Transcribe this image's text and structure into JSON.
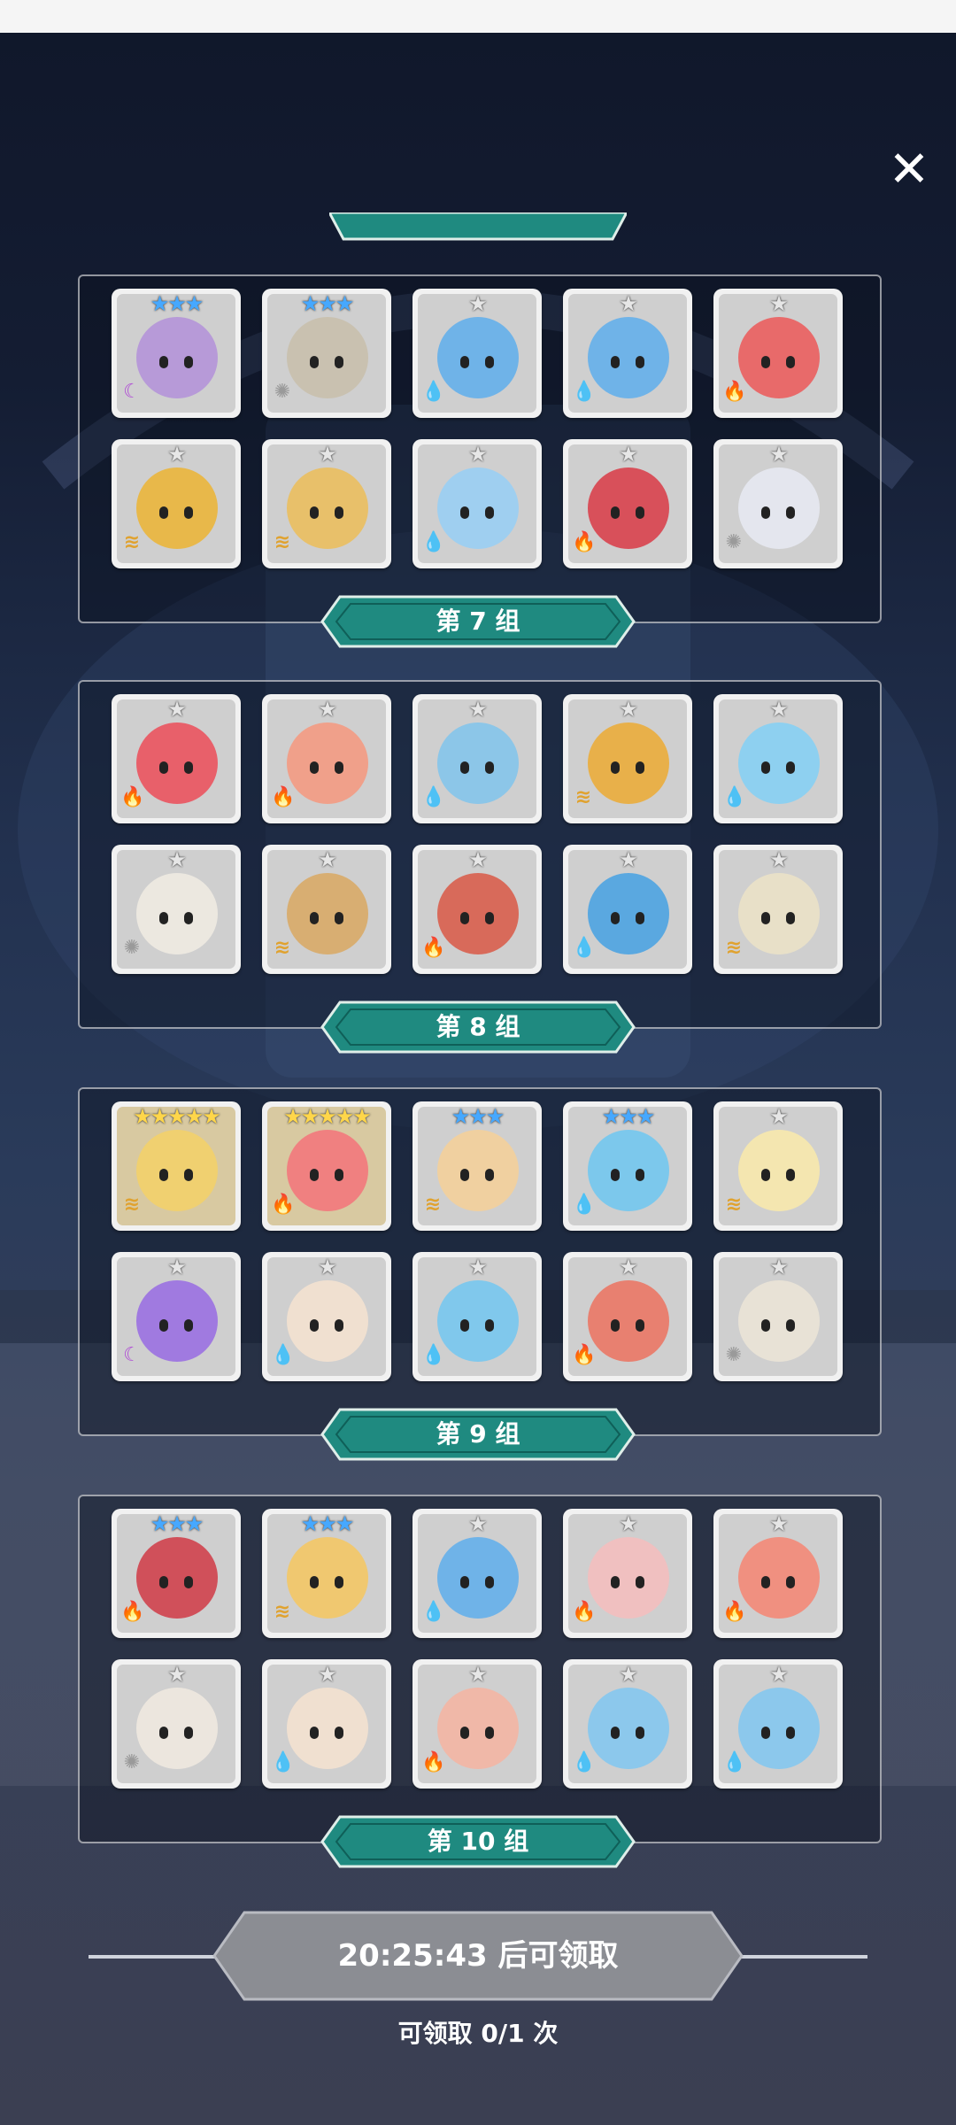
{
  "close_label": "✕",
  "colors": {
    "banner": "#1f8a80",
    "banner_dark": "#0f5f58",
    "button": "#8b8d93",
    "star_gray": "#e6e6e6",
    "star_blue": "#46a8ff",
    "star_gold": "#ffd64a"
  },
  "elements": {
    "fire": {
      "icon": "flame-icon",
      "glyph": "🔥",
      "color": "#e0442f"
    },
    "water": {
      "icon": "water-drop-icon",
      "glyph": "💧",
      "color": "#2f86e0"
    },
    "light": {
      "icon": "sun-icon",
      "glyph": "✺",
      "color": "#9a9a9a"
    },
    "moon": {
      "icon": "moon-icon",
      "glyph": "☾",
      "color": "#b04bd6"
    },
    "wind": {
      "icon": "wind-icon",
      "glyph": "≋",
      "color": "#e0a22f"
    }
  },
  "groups": [
    {
      "banner": "第 7 组",
      "rows": [
        [
          {
            "stars": 3,
            "tier": "blue",
            "element": "moon",
            "color": "#b79ad8"
          },
          {
            "stars": 3,
            "tier": "blue",
            "element": "light",
            "color": "#c9c1b0"
          },
          {
            "stars": 1,
            "tier": "gray",
            "element": "water",
            "color": "#6fb3e8"
          },
          {
            "stars": 1,
            "tier": "gray",
            "element": "water",
            "color": "#6fb3e8"
          },
          {
            "stars": 1,
            "tier": "gray",
            "element": "fire",
            "color": "#e86a6a"
          }
        ],
        [
          {
            "stars": 1,
            "tier": "gray",
            "element": "wind",
            "color": "#e8b84a"
          },
          {
            "stars": 1,
            "tier": "gray",
            "element": "wind",
            "color": "#e8c06a"
          },
          {
            "stars": 1,
            "tier": "gray",
            "element": "water",
            "color": "#9fcff0"
          },
          {
            "stars": 1,
            "tier": "gray",
            "element": "fire",
            "color": "#d8505a"
          },
          {
            "stars": 1,
            "tier": "gray",
            "element": "light",
            "color": "#e4e6ee"
          }
        ]
      ]
    },
    {
      "banner": "第 8 组",
      "rows": [
        [
          {
            "stars": 1,
            "tier": "gray",
            "element": "fire",
            "color": "#e8606a"
          },
          {
            "stars": 1,
            "tier": "gray",
            "element": "fire",
            "color": "#f0a08a"
          },
          {
            "stars": 1,
            "tier": "gray",
            "element": "water",
            "color": "#8cc6e8"
          },
          {
            "stars": 1,
            "tier": "gray",
            "element": "wind",
            "color": "#e8b04a"
          },
          {
            "stars": 1,
            "tier": "gray",
            "element": "water",
            "color": "#8ed0f0"
          }
        ],
        [
          {
            "stars": 1,
            "tier": "gray",
            "element": "light",
            "color": "#ece8e0"
          },
          {
            "stars": 1,
            "tier": "gray",
            "element": "wind",
            "color": "#d8ae72"
          },
          {
            "stars": 1,
            "tier": "gray",
            "element": "fire",
            "color": "#d86a5a"
          },
          {
            "stars": 1,
            "tier": "gray",
            "element": "water",
            "color": "#5aa8e0"
          },
          {
            "stars": 1,
            "tier": "gray",
            "element": "wind",
            "color": "#e8e0c8"
          }
        ]
      ]
    },
    {
      "banner": "第 9 组",
      "rows": [
        [
          {
            "stars": 5,
            "tier": "gold",
            "element": "wind",
            "color": "#f0d070"
          },
          {
            "stars": 5,
            "tier": "gold",
            "element": "fire",
            "color": "#f08080"
          },
          {
            "stars": 3,
            "tier": "blue",
            "element": "wind",
            "color": "#f0d0a0"
          },
          {
            "stars": 3,
            "tier": "blue",
            "element": "water",
            "color": "#7cc8ec"
          },
          {
            "stars": 1,
            "tier": "gray",
            "element": "wind",
            "color": "#f4e6b0"
          }
        ],
        [
          {
            "stars": 1,
            "tier": "gray",
            "element": "moon",
            "color": "#a07ae0"
          },
          {
            "stars": 1,
            "tier": "gray",
            "element": "water",
            "color": "#f0e0d0"
          },
          {
            "stars": 1,
            "tier": "gray",
            "element": "water",
            "color": "#80c8ec"
          },
          {
            "stars": 1,
            "tier": "gray",
            "element": "fire",
            "color": "#e88070"
          },
          {
            "stars": 1,
            "tier": "gray",
            "element": "light",
            "color": "#e8e2d6"
          }
        ]
      ]
    },
    {
      "banner": "第 10 组",
      "rows": [
        [
          {
            "stars": 3,
            "tier": "blue",
            "element": "fire",
            "color": "#d0505a"
          },
          {
            "stars": 3,
            "tier": "blue",
            "element": "wind",
            "color": "#f0c870"
          },
          {
            "stars": 1,
            "tier": "gray",
            "element": "water",
            "color": "#6fb3e8"
          },
          {
            "stars": 1,
            "tier": "gray",
            "element": "fire",
            "color": "#f0c0c0"
          },
          {
            "stars": 1,
            "tier": "gray",
            "element": "fire",
            "color": "#f09080"
          }
        ],
        [
          {
            "stars": 1,
            "tier": "gray",
            "element": "light",
            "color": "#ece6de"
          },
          {
            "stars": 1,
            "tier": "gray",
            "element": "water",
            "color": "#f0e0d0"
          },
          {
            "stars": 1,
            "tier": "gray",
            "element": "fire",
            "color": "#f0b8a8"
          },
          {
            "stars": 1,
            "tier": "gray",
            "element": "water",
            "color": "#8cc8ec"
          },
          {
            "stars": 1,
            "tier": "gray",
            "element": "water",
            "color": "#8cc8ec"
          }
        ]
      ]
    }
  ],
  "claim_button": "20:25:43 后可领取",
  "claim_count": "可领取 0/1 次"
}
